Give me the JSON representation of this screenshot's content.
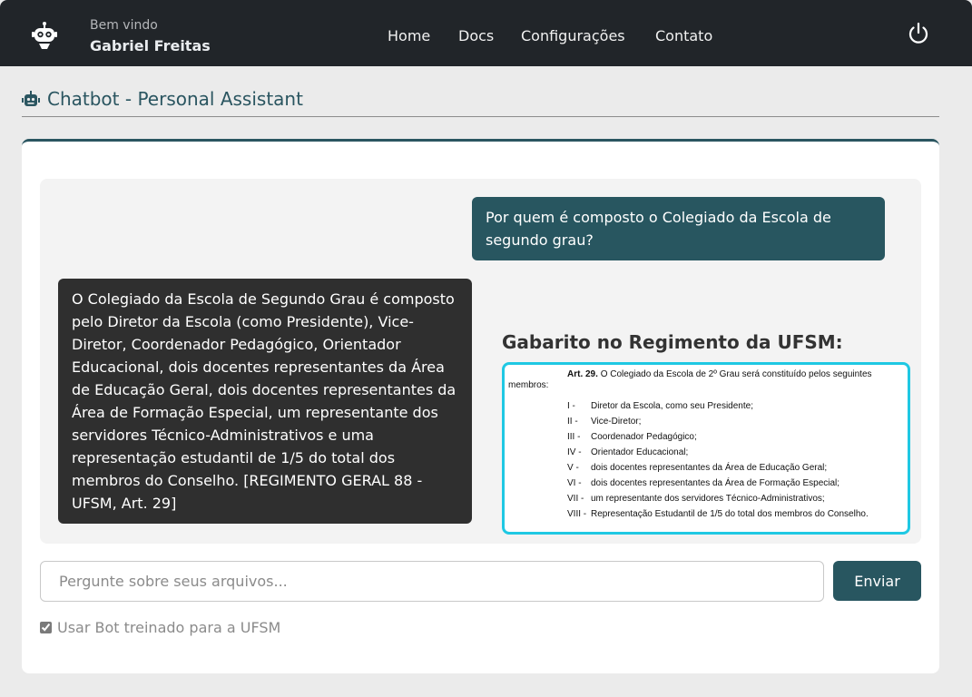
{
  "header": {
    "welcome": "Bem vindo",
    "username": "Gabriel Freitas",
    "nav": [
      "Home",
      "Docs",
      "Configurações",
      "Contato"
    ],
    "logo_icon": "robot-logo-icon",
    "power_icon": "power-icon"
  },
  "page": {
    "title": "Chatbot - Personal Assistant",
    "title_icon": "robot-icon"
  },
  "chat": {
    "user_message": "Por quem é composto o Colegiado da Escola de segundo grau?",
    "bot_message": "O Colegiado da Escola de Segundo Grau é composto pelo Diretor da Escola (como Presidente), Vice-Diretor, Coordenador Pedagógico, Orientador Educacional, dois docentes representantes da Área de Educação Geral, dois docentes representantes da Área de Formação Especial, um representante dos servidores Técnico-Administrativos e uma representação estudantil de 1/5 do total dos membros do Conselho. [REGIMENTO GERAL 88 - UFSM, Art. 29]",
    "reference_title": "Gabarito no Regimento da UFSM:",
    "reference": {
      "article_label": "Art. 29.",
      "article_text": "O Colegiado da Escola de 2º Grau será constituído pelos seguintes",
      "article_text_cont": "membros:",
      "items": [
        {
          "num": "I -",
          "text": "Diretor da Escola, como seu Presidente;"
        },
        {
          "num": "II -",
          "text": "Vice-Diretor;"
        },
        {
          "num": "III -",
          "text": "Coordenador Pedagógico;"
        },
        {
          "num": "IV -",
          "text": "Orientador Educacional;"
        },
        {
          "num": "V -",
          "text": "dois docentes representantes da Área de Educação Geral;"
        },
        {
          "num": "VI -",
          "text": "dois docentes representantes da Área de Formação Especial;"
        },
        {
          "num": "VII -",
          "text": "um representante dos servidores Técnico-Administrativos;"
        },
        {
          "num": "VIII -",
          "text": "Representação Estudantil de 1/5 do total dos membros do Conselho."
        }
      ]
    }
  },
  "input": {
    "placeholder": "Pergunte sobre seus arquivos...",
    "value": "",
    "send_label": "Enviar",
    "checkbox_label": "Usar Bot treinado para a UFSM",
    "checkbox_checked": true
  },
  "colors": {
    "header_bg": "#212529",
    "accent": "#285660",
    "bot_bubble": "#2f2f2f",
    "reference_border": "#1fc8e3"
  }
}
